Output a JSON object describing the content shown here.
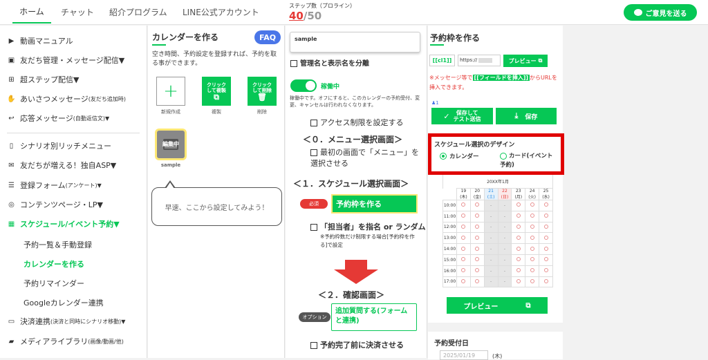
{
  "topnav": {
    "items": [
      "ホーム",
      "チャット",
      "紹介プログラム",
      "LINE公式アカウント"
    ]
  },
  "steps": {
    "label": "ステップ数（プロライン）",
    "current": "40",
    "slash": "/",
    "total": "50"
  },
  "feedback_label": "ご意見を送る",
  "sidebar": {
    "items": [
      {
        "label": "動画マニュアル",
        "icon": "youtube-icon"
      },
      {
        "label": "友だち管理・メッセージ配信▼",
        "icon": "contact-icon"
      },
      {
        "label": "超ステップ配信▼",
        "icon": "hierarchy-icon"
      },
      {
        "label": "あいさつメッセージ",
        "small": "(友だち追加時)",
        "icon": "hand-icon"
      },
      {
        "label": "応答メッセージ",
        "small": "(自動返信文)▼",
        "icon": "reply-icon"
      },
      {
        "label": "シナリオ別リッチメニュー",
        "icon": "phone-icon"
      },
      {
        "label": "友だちが増える！独自ASP▼",
        "icon": "chat-icon"
      },
      {
        "label": "登録フォーム",
        "small": "(アンケート)▼",
        "icon": "list-icon"
      },
      {
        "label": "コンテンツページ・LP▼",
        "icon": "globe-icon"
      },
      {
        "label": "スケジュール/イベント予約▼",
        "icon": "calendar-icon"
      }
    ],
    "subitems": [
      "予約一覧＆手動登録",
      "カレンダーを作る",
      "予約リマインダー",
      "Googleカレンダー連携"
    ],
    "bottom_items": [
      {
        "label": "決済連携",
        "small": "(決済と同時にシナリオ移動)▼",
        "icon": "card-icon"
      },
      {
        "label": "メディアライブラリ",
        "small": "(画像/動画/他)",
        "icon": "folder-icon"
      }
    ]
  },
  "calendar_panel": {
    "title": "カレンダーを作る",
    "faq": "FAQ",
    "desc": "空き時間、予約設定を登録すれば、予約を取る事ができます。",
    "new_label": "新規作成",
    "copy_btn": "クリックして複製",
    "copy_label": "複製",
    "delete_btn": "クリックして削除",
    "delete_label": "削除",
    "card_badge": "編集中",
    "card_label": "sample",
    "hint": "早速、ここから設定してみよう！"
  },
  "settings_panel": {
    "name_value": "sample",
    "separate_label": "管理名と表示名を分離",
    "toggle_label": "稼働中",
    "toggle_note": "稼働中です。オフにすると、このカレンダーの予約受付、変更、キャンセルは行われなくなります。",
    "access_label": "アクセス制限を設定する",
    "step0": "＜０．メニュー選択画面＞",
    "menu_label": "最初の画面で「メニュー」を選択させる",
    "step1": "＜１．スケジュール選択画面＞",
    "required": "必須",
    "frame_btn": "予約枠を作る",
    "staff_label": "「担当者」を指名 or ランダム",
    "staff_note": "※予約枠数だけ制限する場合[予約枠を作る]で設定",
    "step2": "＜２．確認画面＞",
    "option": "オプション",
    "extra_btn": "追加質問する(フォームと連携)",
    "payment_label": "予約完了前に決済させる"
  },
  "frame_panel": {
    "title": "予約枠を作る",
    "code": "[[cl1]]",
    "url_prefix": "https://",
    "preview_btn": "プレビュー",
    "note_prefix": "※メッセージ等で",
    "insert_field": "[[フィールドを挿入]]",
    "note_suffix": "からURLを挿入できます。",
    "person_count": "1",
    "save_test_btn": "保存して\nテスト送信",
    "save_btn": "保存",
    "design_title": "スケジュール選択のデザイン",
    "opt_calendar": "カレンダー",
    "opt_card": "カード(イベント予約)",
    "month": "20XX年1月",
    "days": [
      {
        "d": "19",
        "w": "(木)",
        "color": "#333"
      },
      {
        "d": "20",
        "w": "(金)",
        "color": "#333"
      },
      {
        "d": "21",
        "w": "(土)",
        "color": "#1e88e5"
      },
      {
        "d": "22",
        "w": "(日)",
        "color": "#e53935"
      },
      {
        "d": "23",
        "w": "(月)",
        "color": "#333"
      },
      {
        "d": "24",
        "w": "(火)",
        "color": "#333"
      },
      {
        "d": "25",
        "w": "(水)",
        "color": "#333"
      }
    ],
    "times": [
      "10:00",
      "11:00",
      "12:00",
      "13:00",
      "14:00",
      "15:00",
      "16:00",
      "17:00"
    ],
    "preview_big": "プレビュー",
    "accept_date_label": "予約受付日",
    "accept_date_value": "2025/01/19",
    "accept_date_suffix": "(木)"
  },
  "colors": {
    "green": "#06c755",
    "red_highlight": "#e00000",
    "faq": "#4a76e8",
    "arrow": "#e53935"
  }
}
